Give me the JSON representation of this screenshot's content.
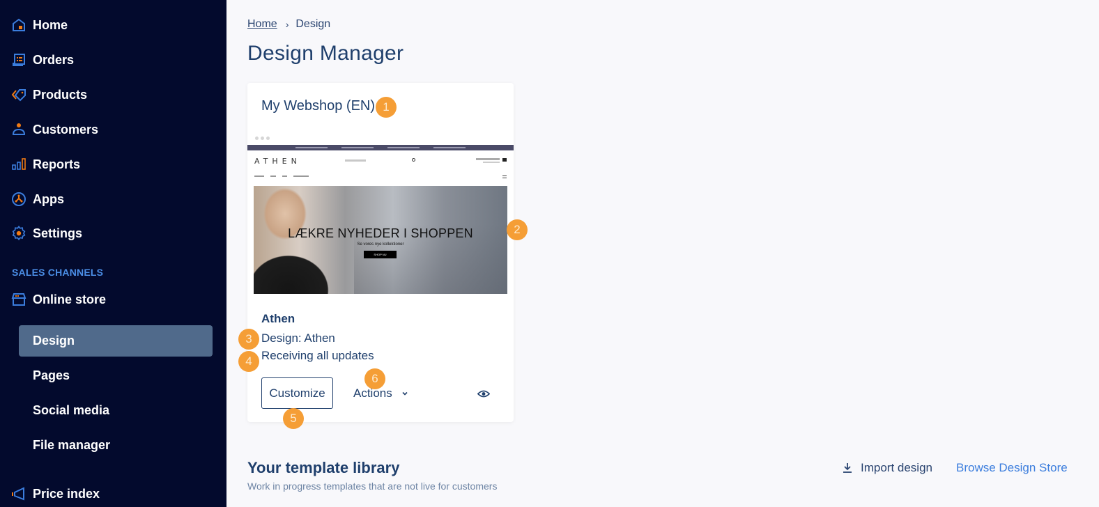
{
  "sidebar": {
    "items": [
      {
        "label": "Home",
        "icon": "home-icon"
      },
      {
        "label": "Orders",
        "icon": "orders-icon"
      },
      {
        "label": "Products",
        "icon": "tag-icon"
      },
      {
        "label": "Customers",
        "icon": "person-icon"
      },
      {
        "label": "Reports",
        "icon": "bar-chart-icon"
      },
      {
        "label": "Apps",
        "icon": "apps-icon"
      },
      {
        "label": "Settings",
        "icon": "gear-icon"
      }
    ],
    "section_label": "SALES CHANNELS",
    "channel": {
      "label": "Online store",
      "icon": "store-icon"
    },
    "sub_items": [
      {
        "label": "Design",
        "active": true
      },
      {
        "label": "Pages",
        "active": false
      },
      {
        "label": "Social media",
        "active": false
      },
      {
        "label": "File manager",
        "active": false
      }
    ],
    "price_index": {
      "label": "Price index",
      "icon": "megaphone-icon"
    }
  },
  "breadcrumb": {
    "home": "Home",
    "separator": "›",
    "current": "Design"
  },
  "page_title": "Design Manager",
  "card": {
    "title": "My Webshop (EN)",
    "preview": {
      "logo": "ATHEN",
      "hero_title": "LÆKRE NYHEDER I SHOPPEN",
      "hero_subtitle": "Se vores nye kollektioner",
      "hero_button": "SHOP NU"
    },
    "theme_name": "Athen",
    "design_label": "Design: Athen",
    "update_status": "Receiving all updates",
    "customize_label": "Customize",
    "actions_label": "Actions"
  },
  "badges": [
    "1",
    "2",
    "3",
    "4",
    "5",
    "6"
  ],
  "library": {
    "title": "Your template library",
    "subtitle": "Work in progress templates that are not live for customers",
    "import_label": "Import design",
    "browse_label": "Browse Design Store"
  },
  "colors": {
    "sidebar_bg": "#030a2d",
    "active_item": "#506a8b",
    "accent_blue": "#3b7ddd",
    "badge": "#f59e36",
    "heading": "#1f3f6c"
  }
}
